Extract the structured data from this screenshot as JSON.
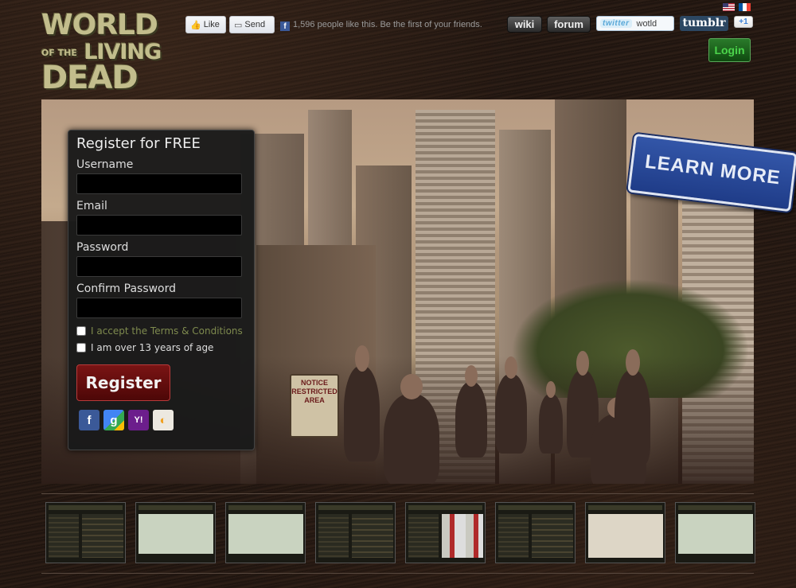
{
  "header": {
    "logo": {
      "line1": "WORLD",
      "line2_small": "OF THE",
      "line2": "LIVING",
      "line3": "DEAD"
    },
    "facebook": {
      "like_label": "Like",
      "send_label": "Send",
      "social_text": "1,596 people like this. Be the first of your friends."
    },
    "nav": {
      "wiki": "wiki",
      "forum": "forum"
    },
    "twitter": {
      "brand": "twitter",
      "handle": "wotld"
    },
    "tumblr": "tumblr",
    "gplus": "+1",
    "login": "Login"
  },
  "hero": {
    "learn_more": "LEARN MORE",
    "notice_sign": "NOTICE RESTRICTED AREA"
  },
  "register": {
    "title": "Register for FREE",
    "username_label": "Username",
    "email_label": "Email",
    "password_label": "Password",
    "confirm_label": "Confirm Password",
    "terms_label": "I accept the Terms & Conditions",
    "age_label": "I am over 13 years of age",
    "submit_label": "Register",
    "social_logins": [
      "facebook",
      "google",
      "yahoo",
      "openid"
    ]
  },
  "thumbnails": [
    "screenshot-1",
    "screenshot-2",
    "screenshot-3",
    "screenshot-4",
    "screenshot-5",
    "screenshot-6",
    "screenshot-7",
    "screenshot-8"
  ],
  "colors": {
    "login_green": "#1a6b1a",
    "register_red": "#6a0d0d",
    "learn_more_blue": "#2a4a9a",
    "terms_olive": "#7e8a4e"
  }
}
